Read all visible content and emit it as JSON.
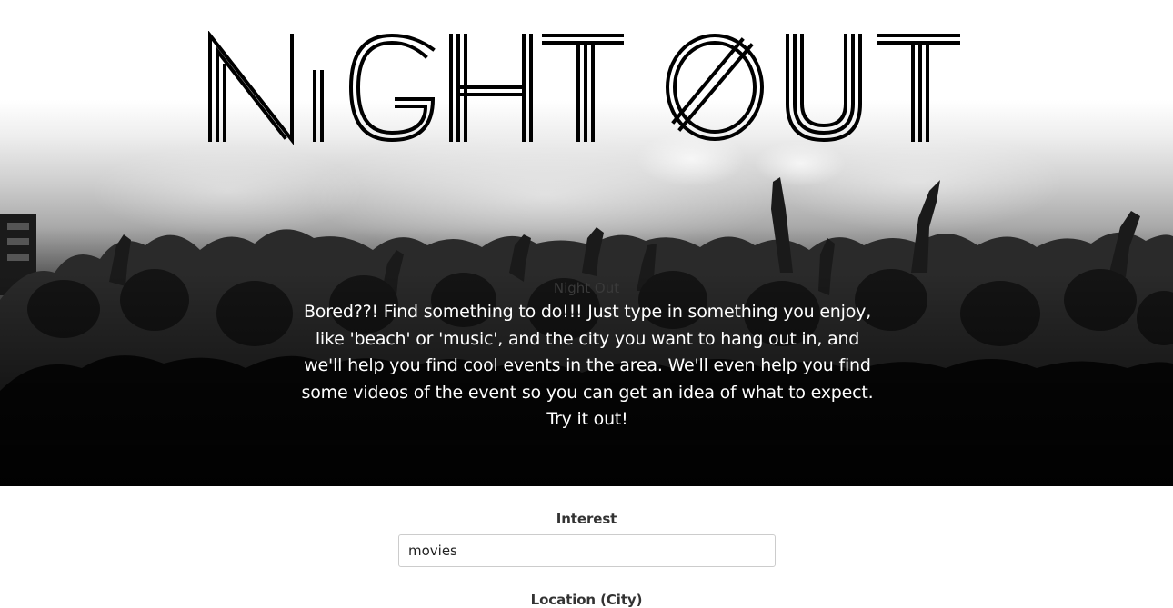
{
  "hero": {
    "logo_text": "NIGHT OUT",
    "heading": "Night Out",
    "description": "Bored??! Find something to do!!! Just type in something you enjoy, like 'beach' or 'music', and the city you want to hang out in, and we'll help you find cool events in the area. We'll even help you find some videos of the event so you can get an idea of what to expect. Try it out!"
  },
  "form": {
    "interest_label": "Interest",
    "interest_value": "movies",
    "location_label": "Location (City)"
  }
}
